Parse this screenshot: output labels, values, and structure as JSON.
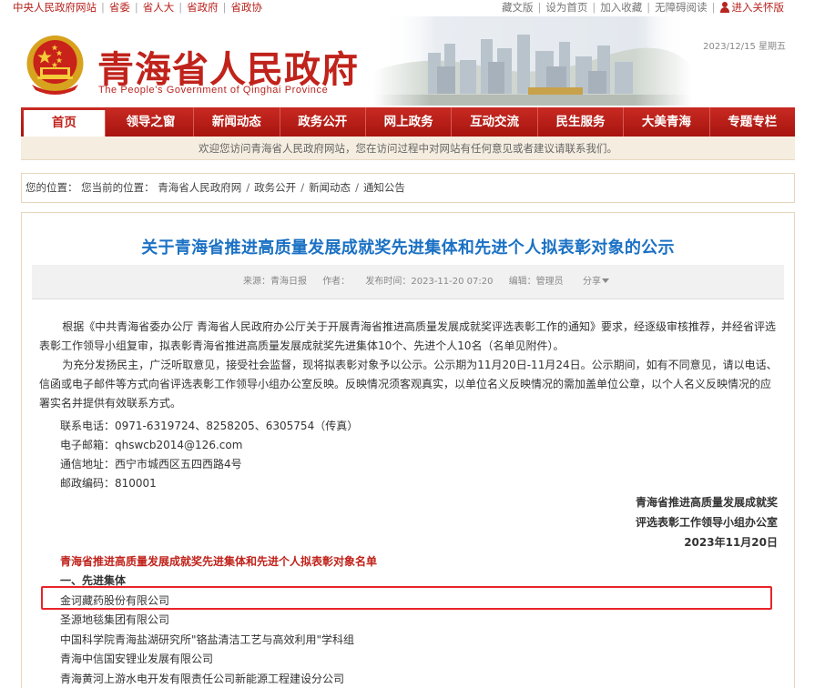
{
  "topbar": {
    "left_links": [
      "中央人民政府网站",
      "省委",
      "省人大",
      "省政府",
      "省政协"
    ],
    "right_links": [
      "藏文版",
      "设为首页",
      "加入收藏",
      "无障碍阅读"
    ],
    "care_mode": "进入关怀版"
  },
  "header": {
    "title": "青海省人民政府",
    "subtitle": "The People's Government of Qinghai Province",
    "date": "2023/12/15 星期五"
  },
  "nav": {
    "items": [
      "首页",
      "领导之窗",
      "新闻动态",
      "政务公开",
      "网上政务",
      "互动交流",
      "民生服务",
      "大美青海",
      "专题专栏"
    ]
  },
  "welcome": "欢迎您访问青海省人民政府网站，您在访问过程中对网站有任何意见或者建议请联系我们。",
  "breadcrumb": {
    "prefix": "您的位置：",
    "current_label": "您当前的位置：",
    "items": [
      "青海省人民政府网",
      "政务公开",
      "新闻动态",
      "通知公告"
    ]
  },
  "article": {
    "title": "关于青海省推进高质量发展成就奖先进集体和先进个人拟表彰对象的公示",
    "meta": {
      "source": "来源：青海日报",
      "author": "作者：",
      "published": "发布时间：2023-11-20 07:20",
      "editor": "编辑：管理员",
      "share": "分享"
    },
    "paragraph1": "根据《中共青海省委办公厅 青海省人民政府办公厅关于开展青海省推进高质量发展成就奖评选表彰工作的通知》要求，经逐级审核推荐，并经省评选表彰工作领导小组复审，拟表彰青海省推进高质量发展成就奖先进集体10个、先进个人10名（名单见附件）。",
    "paragraph2": "为充分发扬民主，广泛听取意见，接受社会监督，现将拟表彰对象予以公示。公示期为11月20日-11月24日。公示期间，如有不同意见，请以电话、信函或电子邮件等方式向省评选表彰工作领导小组办公室反映。反映情况须客观真实，以单位名义反映情况的需加盖单位公章，以个人名义反映情况的应署实名并提供有效联系方式。",
    "contacts": {
      "phone": "联系电话：0971-6319724、8258205、6305754（传真）",
      "email": "电子邮箱：qhswcb2014@126.com",
      "address": "通信地址：西宁市城西区五四西路4号",
      "postcode": "邮政编码：810001"
    },
    "signature": {
      "org1": "青海省推进高质量发展成就奖",
      "org2": "评选表彰工作领导小组办公室",
      "date": "2023年11月20日"
    },
    "list_title": "青海省推进高质量发展成就奖先进集体和先进个人拟表彰对象名单",
    "section_title": "一、先进集体",
    "collectives": [
      "金诃藏药股份有限公司",
      "圣源地毯集团有限公司",
      "中国科学院青海盐湖研究所\"铬盐清洁工艺与高效利用\"学科组",
      "青海中信国安锂业发展有限公司",
      "青海黄河上游水电开发有限责任公司新能源工程建设分公司"
    ]
  },
  "colors": {
    "brand_red": "#c0231b",
    "title_blue": "#1b71c4",
    "highlight_red": "#e8242a"
  }
}
